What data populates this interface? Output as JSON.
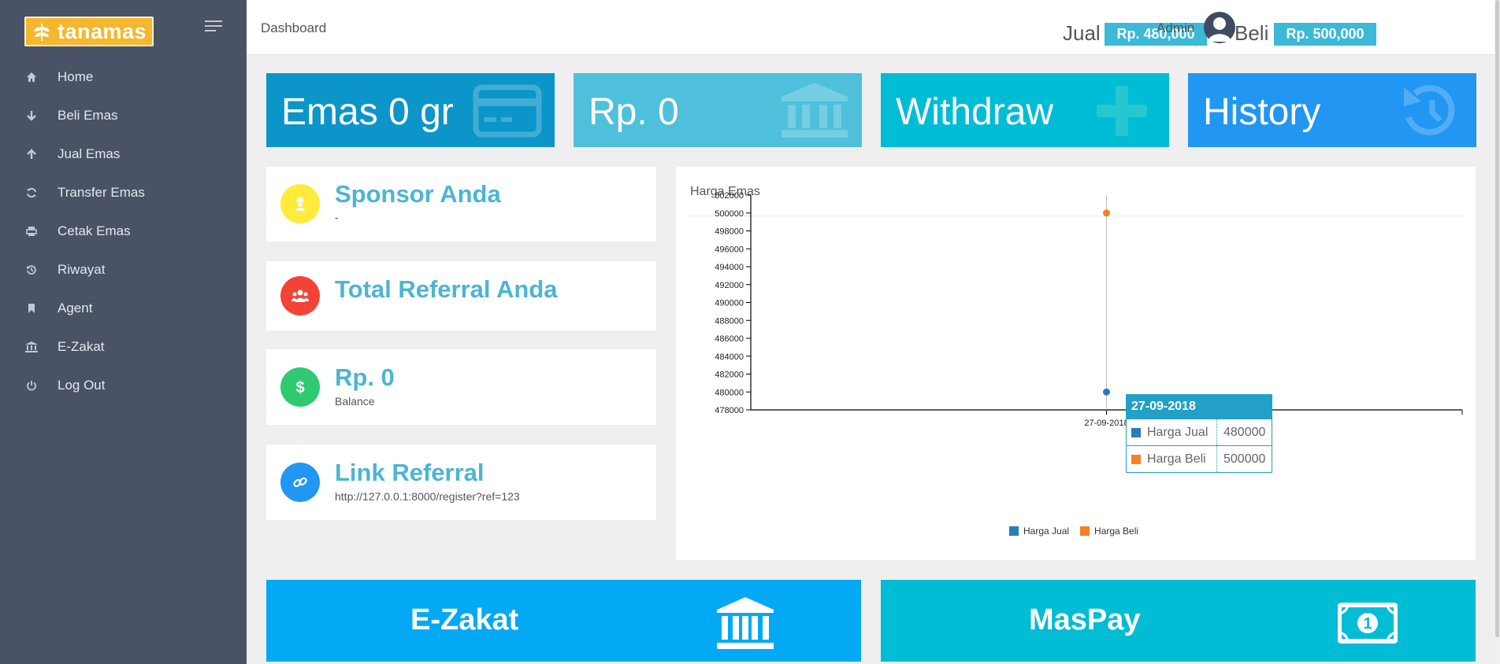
{
  "brand": {
    "name": "tanamas"
  },
  "sidebar": {
    "items": [
      {
        "label": "Home",
        "icon": "home-icon"
      },
      {
        "label": "Beli Emas",
        "icon": "arrow-down-icon"
      },
      {
        "label": "Jual Emas",
        "icon": "arrow-up-icon"
      },
      {
        "label": "Transfer Emas",
        "icon": "refresh-icon"
      },
      {
        "label": "Cetak Emas",
        "icon": "print-icon"
      },
      {
        "label": "Riwayat",
        "icon": "history-icon"
      },
      {
        "label": "Agent",
        "icon": "bookmark-icon"
      },
      {
        "label": "E-Zakat",
        "icon": "bank-icon"
      },
      {
        "label": "Log Out",
        "icon": "power-icon"
      }
    ]
  },
  "topbar": {
    "breadcrumb": "Dashboard",
    "jual_label": "Jual",
    "jual_price": "Rp. 480,000",
    "beli_label": "Beli",
    "beli_price": "Rp. 500,000",
    "user": "Admin"
  },
  "tiles": [
    {
      "text": "Emas 0 gr",
      "color": "#0b95c9",
      "icon": "credit-card-icon"
    },
    {
      "text": "Rp. 0",
      "color": "#4ec0dc",
      "icon": "bank-icon"
    },
    {
      "text": "Withdraw",
      "color": "#00bcd4",
      "icon": "plus-icon"
    },
    {
      "text": "History",
      "color": "#2196f3",
      "icon": "history-icon"
    }
  ],
  "cards": {
    "sponsor": {
      "title": "Sponsor Anda",
      "sub": "-",
      "color": "#ffeb3b"
    },
    "referral_total": {
      "title": "Total Referral Anda",
      "color": "#f44336"
    },
    "balance": {
      "title": "Rp. 0",
      "sub": "Balance",
      "color": "#2ec971"
    },
    "link": {
      "title": "Link Referral",
      "sub": "http://127.0.0.1:8000/register?ref=123",
      "color": "#2196f3"
    }
  },
  "chart_panel": {
    "title": "Harga Emas"
  },
  "chart_data": {
    "type": "line",
    "x": [
      "27-09-2018"
    ],
    "series": [
      {
        "name": "Harga Jual",
        "values": [
          480000
        ],
        "color": "#2b7cb9"
      },
      {
        "name": "Harga Beli",
        "values": [
          500000
        ],
        "color": "#f58220"
      }
    ],
    "y_ticks": [
      "478000",
      "480000",
      "482000",
      "484000",
      "486000",
      "488000",
      "490000",
      "492000",
      "494000",
      "496000",
      "498000",
      "500000",
      "502000"
    ],
    "ylim": [
      478000,
      502000
    ],
    "legend": "bottom",
    "tooltip": {
      "title": "27-09-2018",
      "rows": [
        {
          "name": "Harga Jual",
          "value": "480000"
        },
        {
          "name": "Harga Beli",
          "value": "500000"
        }
      ]
    }
  },
  "bottom_tiles": [
    {
      "text": "E-Zakat",
      "color": "#03a9f4",
      "icon": "bank-icon"
    },
    {
      "text": "MasPay",
      "color": "#00bcd4",
      "icon": "money-icon"
    }
  ]
}
